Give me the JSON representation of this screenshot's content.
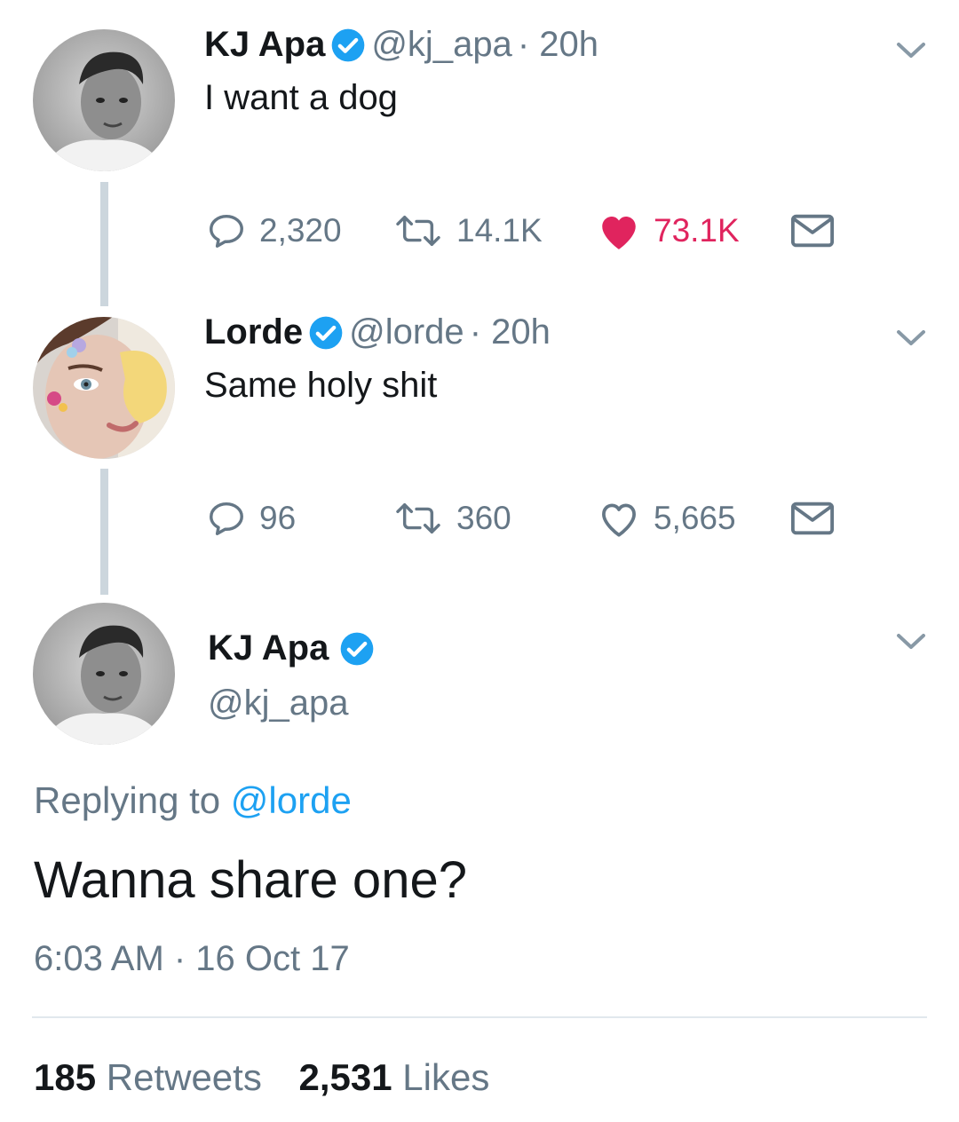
{
  "tweets": [
    {
      "author_name": "KJ Apa",
      "author_handle": "@kj_apa",
      "time": "· 20h",
      "text": "I want a dog",
      "replies": "2,320",
      "retweets": "14.1K",
      "likes": "73.1K",
      "liked": true
    },
    {
      "author_name": "Lorde",
      "author_handle": "@lorde",
      "time": "· 20h",
      "text": "Same holy shit",
      "replies": "96",
      "retweets": "360",
      "likes": "5,665",
      "liked": false
    }
  ],
  "focused": {
    "author_name": "KJ Apa",
    "author_handle": "@kj_apa",
    "replying_prefix": "Replying to",
    "replying_to": "@lorde",
    "text": "Wanna share one?",
    "timestamp": "6:03 AM · 16 Oct 17",
    "retweets_count": "185",
    "retweets_label": "Retweets",
    "likes_count": "2,531",
    "likes_label": "Likes"
  },
  "colors": {
    "verified": "#1da1f2",
    "like_active": "#e0245e",
    "secondary_text": "#657786",
    "thread_line": "#ccd6dd"
  },
  "icons": [
    "reply-icon",
    "retweet-icon",
    "heart-icon",
    "dm-icon",
    "verified-badge-icon",
    "chevron-down-icon"
  ]
}
